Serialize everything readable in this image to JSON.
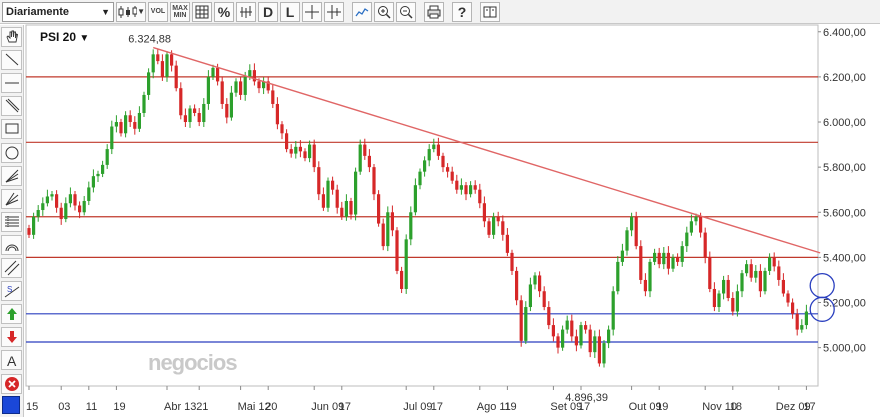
{
  "toolbar": {
    "period_select": "Diariamente",
    "vol_label": "VOL",
    "maxmin_label_top": "MAX",
    "maxmin_label_bottom": "MIN",
    "percent_label": "%",
    "d_label": "D",
    "l_label": "L",
    "help_label": "?"
  },
  "sidebar": {
    "tools": [
      "hand-icon",
      "trendline-icon",
      "horizontal-line-icon",
      "diagonal-line-icon",
      "rectangle-icon",
      "circle-icon",
      "fan-icon",
      "gann-icon",
      "fibonacci-icon",
      "arc-icon",
      "parallel-channel-icon",
      "regression-icon",
      "up-arrow-icon",
      "down-arrow-icon",
      "text-icon",
      "delete-icon"
    ],
    "text_tool_label": "A",
    "color": "#1a47d8"
  },
  "chart_data": {
    "type": "candlestick",
    "symbol": "PSI 20",
    "ylim": [
      4830,
      6430
    ],
    "y_ticks": [
      "5.000,00",
      "5.200,00",
      "5.400,00",
      "5.600,00",
      "5.800,00",
      "6.000,00",
      "6.200,00",
      "6.400,00"
    ],
    "y_tick_values": [
      5000,
      5200,
      5400,
      5600,
      5800,
      6000,
      6200,
      6400
    ],
    "x_ticks": [
      "15",
      "03",
      "11",
      "19",
      "Abr 13",
      "21",
      "Mai 12",
      "20",
      "Jun 09",
      "17",
      "Jul 09",
      "17",
      "Ago 11",
      "19",
      "Set 09",
      "17",
      "Out 09",
      "19",
      "Nov 10",
      "18",
      "Dez 09",
      "17"
    ],
    "x_tick_index": [
      0,
      7,
      13,
      19,
      30,
      37,
      46,
      52,
      62,
      68,
      82,
      88,
      98,
      104,
      114,
      120,
      131,
      137,
      147,
      153,
      163,
      169
    ],
    "annotations": [
      {
        "text": "6.324,88",
        "index": 27,
        "value": 6324.88
      },
      {
        "text": "4.896,39",
        "index": 122,
        "value": 4896.39
      }
    ],
    "horizontal_lines": [
      {
        "value": 6200,
        "color": "#c0392b"
      },
      {
        "value": 5910,
        "color": "#c0392b"
      },
      {
        "value": 5580,
        "color": "#c0392b"
      },
      {
        "value": 5400,
        "color": "#c0392b"
      },
      {
        "value": 5150,
        "color": "#2a3fbf"
      },
      {
        "value": 5025,
        "color": "#2a3fbf"
      }
    ],
    "trendline": {
      "from": {
        "index": 27,
        "value": 6330
      },
      "to": {
        "index": 172,
        "value": 5420
      },
      "color": "#e06666"
    },
    "markers": [
      {
        "index": 172,
        "value": 5275,
        "color": "#2a3fbf"
      },
      {
        "index": 172,
        "value": 5170,
        "color": "#2a3fbf"
      }
    ],
    "colors": {
      "up": "#2ca02c",
      "down": "#d62728"
    },
    "candles": [
      [
        5530,
        5500
      ],
      [
        5500,
        5580
      ],
      [
        5580,
        5610
      ],
      [
        5610,
        5640
      ],
      [
        5640,
        5670
      ],
      [
        5670,
        5680
      ],
      [
        5680,
        5620
      ],
      [
        5620,
        5570
      ],
      [
        5570,
        5640
      ],
      [
        5640,
        5680
      ],
      [
        5680,
        5630
      ],
      [
        5630,
        5600
      ],
      [
        5600,
        5650
      ],
      [
        5650,
        5710
      ],
      [
        5710,
        5760
      ],
      [
        5760,
        5770
      ],
      [
        5770,
        5810
      ],
      [
        5810,
        5880
      ],
      [
        5880,
        5980
      ],
      [
        5980,
        6000
      ],
      [
        6000,
        5950
      ],
      [
        5950,
        6030
      ],
      [
        6030,
        6000
      ],
      [
        6000,
        5970
      ],
      [
        5970,
        6040
      ],
      [
        6040,
        6120
      ],
      [
        6120,
        6220
      ],
      [
        6220,
        6300
      ],
      [
        6300,
        6270
      ],
      [
        6270,
        6200
      ],
      [
        6200,
        6300
      ],
      [
        6300,
        6250
      ],
      [
        6250,
        6150
      ],
      [
        6150,
        6030
      ],
      [
        6030,
        6000
      ],
      [
        6000,
        6060
      ],
      [
        6060,
        6040
      ],
      [
        6040,
        6000
      ],
      [
        6000,
        6080
      ],
      [
        6080,
        6200
      ],
      [
        6200,
        6240
      ],
      [
        6240,
        6180
      ],
      [
        6180,
        6080
      ],
      [
        6080,
        6020
      ],
      [
        6020,
        6130
      ],
      [
        6130,
        6180
      ],
      [
        6180,
        6120
      ],
      [
        6120,
        6200
      ],
      [
        6200,
        6230
      ],
      [
        6230,
        6180
      ],
      [
        6180,
        6150
      ],
      [
        6150,
        6180
      ],
      [
        6180,
        6140
      ],
      [
        6140,
        6080
      ],
      [
        6080,
        5990
      ],
      [
        5990,
        5950
      ],
      [
        5950,
        5880
      ],
      [
        5880,
        5860
      ],
      [
        5860,
        5890
      ],
      [
        5890,
        5870
      ],
      [
        5870,
        5840
      ],
      [
        5840,
        5900
      ],
      [
        5900,
        5800
      ],
      [
        5800,
        5680
      ],
      [
        5680,
        5620
      ],
      [
        5620,
        5740
      ],
      [
        5740,
        5700
      ],
      [
        5700,
        5620
      ],
      [
        5620,
        5580
      ],
      [
        5580,
        5650
      ],
      [
        5650,
        5590
      ],
      [
        5590,
        5780
      ],
      [
        5780,
        5900
      ],
      [
        5900,
        5850
      ],
      [
        5850,
        5800
      ],
      [
        5800,
        5680
      ],
      [
        5680,
        5550
      ],
      [
        5550,
        5450
      ],
      [
        5450,
        5600
      ],
      [
        5600,
        5520
      ],
      [
        5520,
        5340
      ],
      [
        5340,
        5260
      ],
      [
        5260,
        5480
      ],
      [
        5480,
        5600
      ],
      [
        5600,
        5720
      ],
      [
        5720,
        5780
      ],
      [
        5780,
        5830
      ],
      [
        5830,
        5880
      ],
      [
        5880,
        5900
      ],
      [
        5900,
        5850
      ],
      [
        5850,
        5800
      ],
      [
        5800,
        5780
      ],
      [
        5780,
        5740
      ],
      [
        5740,
        5700
      ],
      [
        5700,
        5720
      ],
      [
        5720,
        5680
      ],
      [
        5680,
        5720
      ],
      [
        5720,
        5700
      ],
      [
        5700,
        5640
      ],
      [
        5640,
        5560
      ],
      [
        5560,
        5500
      ],
      [
        5500,
        5580
      ],
      [
        5580,
        5560
      ],
      [
        5560,
        5500
      ],
      [
        5500,
        5420
      ],
      [
        5420,
        5340
      ],
      [
        5340,
        5210
      ],
      [
        5210,
        5030
      ],
      [
        5030,
        5180
      ],
      [
        5180,
        5280
      ],
      [
        5280,
        5320
      ],
      [
        5320,
        5250
      ],
      [
        5250,
        5180
      ],
      [
        5180,
        5100
      ],
      [
        5100,
        5050
      ],
      [
        5050,
        5000
      ],
      [
        5000,
        5080
      ],
      [
        5080,
        5120
      ],
      [
        5120,
        5050
      ],
      [
        5050,
        5010
      ],
      [
        5010,
        5100
      ],
      [
        5100,
        5080
      ],
      [
        5080,
        4980
      ],
      [
        4980,
        5050
      ],
      [
        5050,
        4930
      ],
      [
        4930,
        5020
      ],
      [
        5020,
        5080
      ],
      [
        5080,
        5250
      ],
      [
        5250,
        5380
      ],
      [
        5380,
        5430
      ],
      [
        5430,
        5520
      ],
      [
        5520,
        5580
      ],
      [
        5580,
        5450
      ],
      [
        5450,
        5300
      ],
      [
        5300,
        5250
      ],
      [
        5250,
        5380
      ],
      [
        5380,
        5420
      ],
      [
        5420,
        5370
      ],
      [
        5370,
        5420
      ],
      [
        5420,
        5350
      ],
      [
        5350,
        5400
      ],
      [
        5400,
        5380
      ],
      [
        5380,
        5450
      ],
      [
        5450,
        5510
      ],
      [
        5510,
        5560
      ],
      [
        5560,
        5580
      ],
      [
        5580,
        5510
      ],
      [
        5510,
        5400
      ],
      [
        5400,
        5260
      ],
      [
        5260,
        5180
      ],
      [
        5180,
        5240
      ],
      [
        5240,
        5300
      ],
      [
        5300,
        5220
      ],
      [
        5220,
        5160
      ],
      [
        5160,
        5250
      ],
      [
        5250,
        5330
      ],
      [
        5330,
        5370
      ],
      [
        5370,
        5310
      ],
      [
        5310,
        5340
      ],
      [
        5340,
        5250
      ],
      [
        5250,
        5340
      ],
      [
        5340,
        5400
      ],
      [
        5400,
        5360
      ],
      [
        5360,
        5300
      ],
      [
        5300,
        5240
      ],
      [
        5240,
        5200
      ],
      [
        5200,
        5150
      ],
      [
        5150,
        5080
      ],
      [
        5080,
        5100
      ],
      [
        5100,
        5160
      ]
    ]
  },
  "watermark": "negocios"
}
